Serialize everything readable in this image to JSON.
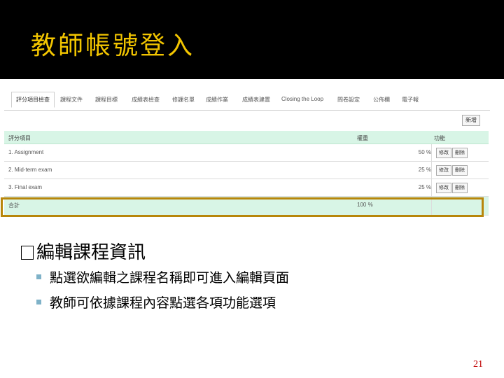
{
  "slide": {
    "title": "教師帳號登入",
    "page_number": "21",
    "colors": {
      "title": "#f2c500",
      "title_bar": "#000000",
      "highlight_border": "#b8860b",
      "header_bg": "#d8f5e6"
    }
  },
  "tabs": [
    {
      "label": "評分項目檢查",
      "active": true
    },
    {
      "label": "課程文件",
      "active": false
    },
    {
      "label": "課程目標",
      "active": false
    },
    {
      "label": "成績表檢查",
      "active": false
    },
    {
      "label": "修課名單",
      "active": false
    },
    {
      "label": "成績作業",
      "active": false
    },
    {
      "label": "成績表建置",
      "active": false
    },
    {
      "label": "Closing the Loop",
      "active": false
    },
    {
      "label": "問卷設定",
      "active": false
    },
    {
      "label": "公佈欄",
      "active": false
    },
    {
      "label": "電子報",
      "active": false
    }
  ],
  "toolbar": {
    "edit_label": "新增"
  },
  "table": {
    "headers": {
      "item": "評分項目",
      "weight": "權重",
      "function": "功能"
    },
    "rows": [
      {
        "item": "1. Assignment",
        "percent": "50 %",
        "edit": "修改",
        "delete": "刪除"
      },
      {
        "item": "2. Mid-term exam",
        "percent": "25 %",
        "edit": "修改",
        "delete": "刪除"
      },
      {
        "item": "3. Final exam",
        "percent": "25 %",
        "edit": "修改",
        "delete": "刪除"
      }
    ],
    "total": {
      "label": "合計",
      "value": "100 %"
    }
  },
  "bullets": {
    "main": "編輯課程資訊",
    "sub": [
      "點選欲編輯之課程名稱即可進入編輯頁面",
      "教師可依據課程內容點選各項功能選項"
    ]
  }
}
